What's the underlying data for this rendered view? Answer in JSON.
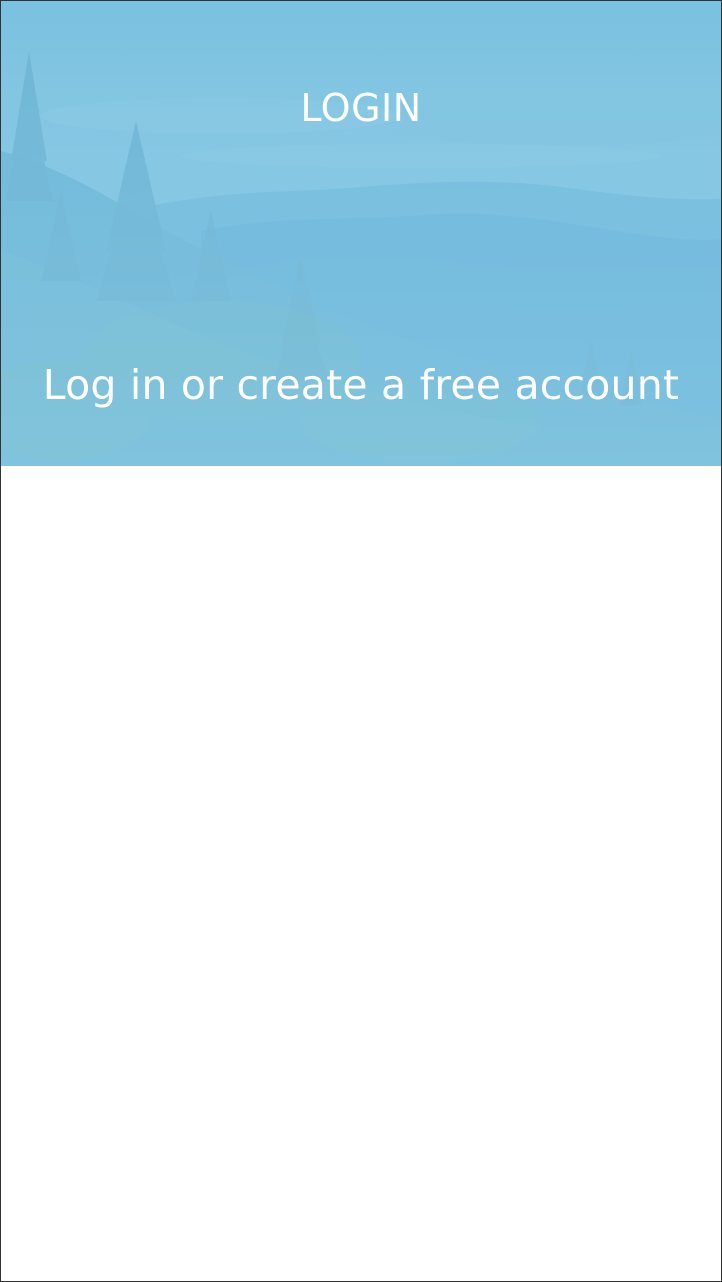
{
  "header": {
    "title": "LOGIN",
    "subtitle": "Log in or create a free account"
  },
  "colors": {
    "sky": "#7cc4e2",
    "overlay": "#76c0e0",
    "text": "#ffffff",
    "background": "#ffffff"
  },
  "icons": {
    "hero_image": "forest-mountain-landscape"
  }
}
